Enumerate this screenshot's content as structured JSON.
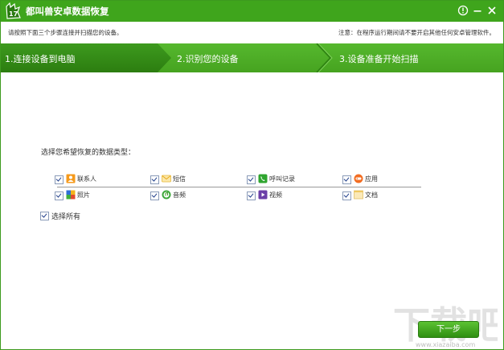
{
  "window": {
    "title": "都叫兽安卓数据恢复",
    "logo_text": "17",
    "controls": [
      "help-icon",
      "minimize-icon",
      "close-icon"
    ]
  },
  "subheader": {
    "instruction": "请按照下面三个步骤连接并扫描您的设备。",
    "notice": "注意：在程序运行期间请不要开启其他任何安卓管理软件。"
  },
  "steps": [
    {
      "label": "1.连接设备到电脑"
    },
    {
      "label": "2.识别您的设备"
    },
    {
      "label": "3.设备准备开始扫描"
    }
  ],
  "prompt": "选择您希望恢复的数据类型：",
  "options": [
    {
      "label": "联系人",
      "icon": "contacts-icon",
      "checked": true
    },
    {
      "label": "短信",
      "icon": "sms-icon",
      "checked": true
    },
    {
      "label": "呼叫记录",
      "icon": "call-log-icon",
      "checked": true
    },
    {
      "label": "应用",
      "icon": "apps-icon",
      "checked": true
    },
    {
      "label": "照片",
      "icon": "photos-icon",
      "checked": true
    },
    {
      "label": "音频",
      "icon": "audio-icon",
      "checked": true
    },
    {
      "label": "视频",
      "icon": "video-icon",
      "checked": true
    },
    {
      "label": "文档",
      "icon": "documents-icon",
      "checked": true
    }
  ],
  "select_all": {
    "label": "选择所有",
    "checked": true
  },
  "next_button": "下一步",
  "watermark": {
    "main": "下载吧",
    "sub": "www.xiazaiba.com"
  },
  "colors": {
    "brand_green": "#3fa51c",
    "step_dark": "#2e7d12",
    "check_blue": "#1e3d8a"
  }
}
